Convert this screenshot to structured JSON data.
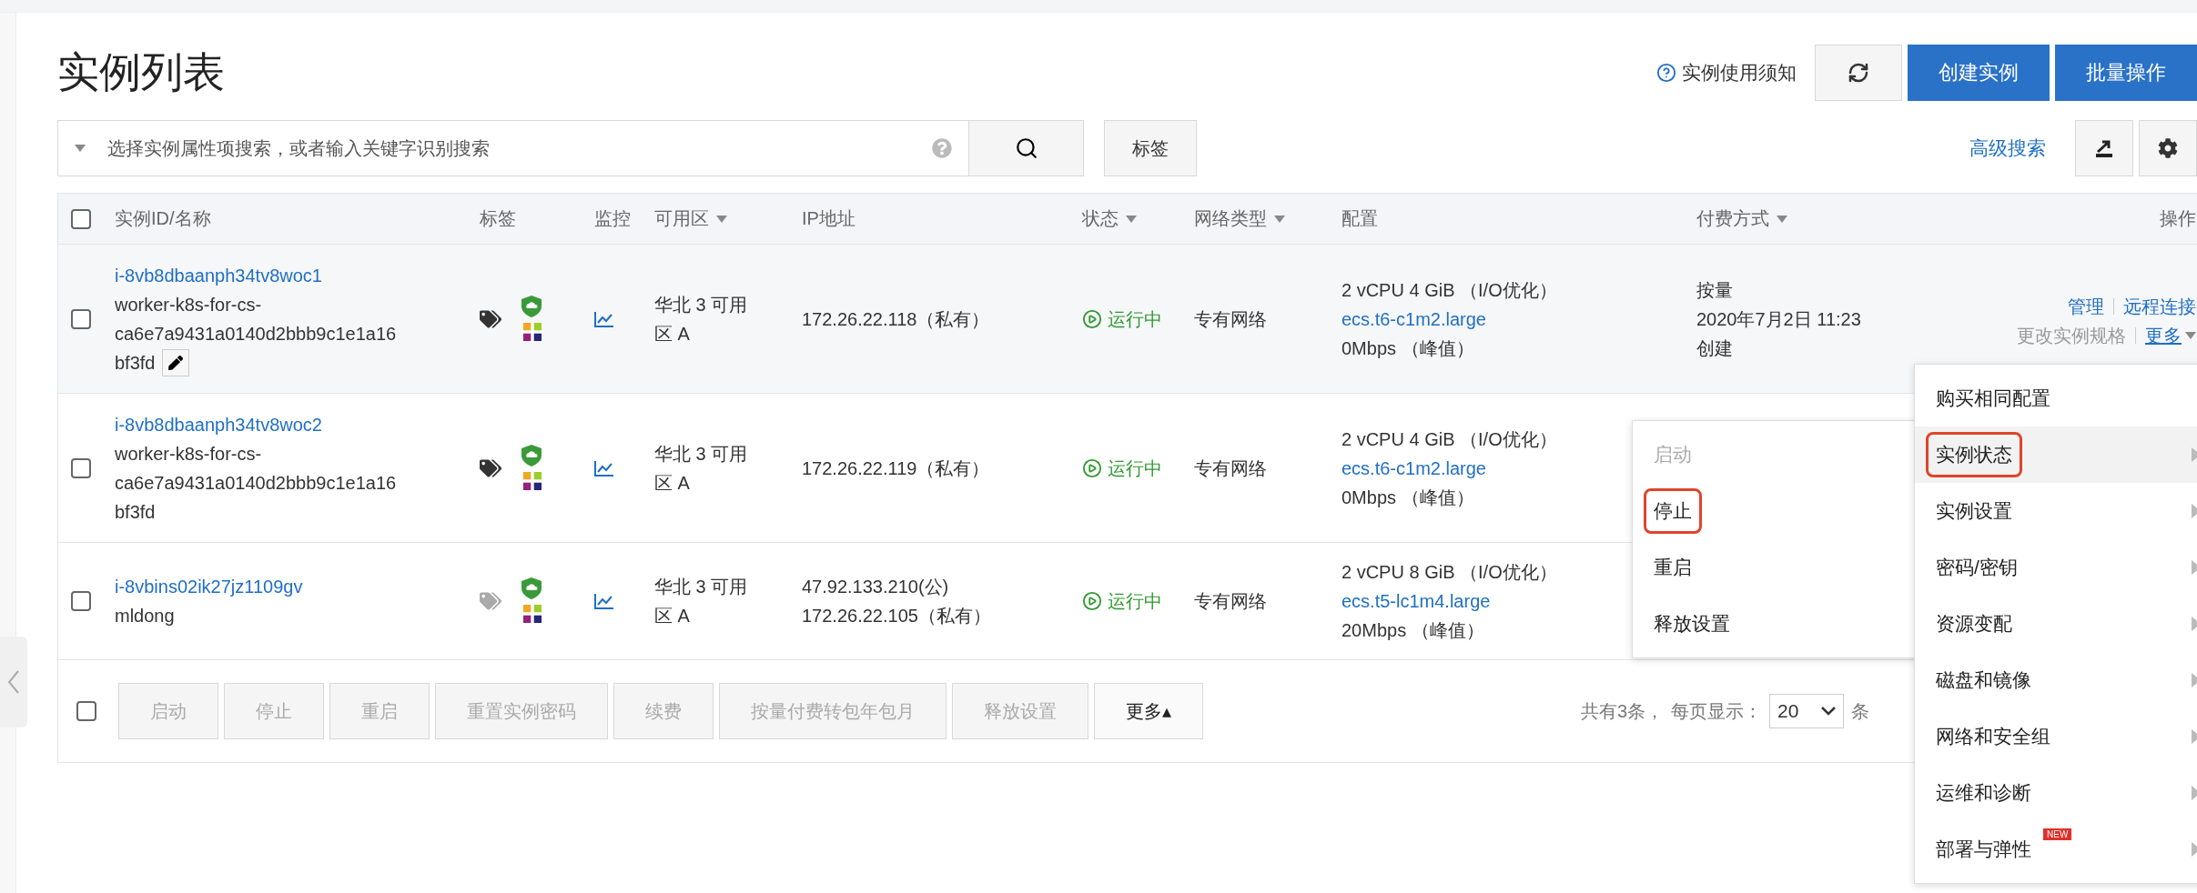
{
  "page_title": "实例列表",
  "header_actions": {
    "notice": "实例使用须知",
    "buttons": [
      {
        "label": "创建实例"
      },
      {
        "label": "批量操作"
      }
    ]
  },
  "search": {
    "placeholder": "选择实例属性项搜索，或者输入关键字识别搜索",
    "tag_button": "标签",
    "advanced": "高级搜索"
  },
  "table": {
    "header_checked": false,
    "columns": [
      {
        "label": "实例ID/名称",
        "sortable": false
      },
      {
        "label": "标签",
        "sortable": false
      },
      {
        "label": "监控",
        "sortable": false
      },
      {
        "label": "可用区",
        "sortable": true
      },
      {
        "label": "IP地址",
        "sortable": false
      },
      {
        "label": "状态",
        "sortable": true
      },
      {
        "label": "网络类型",
        "sortable": true
      },
      {
        "label": "配置",
        "sortable": false
      },
      {
        "label": "付费方式",
        "sortable": true
      },
      {
        "label": "操作",
        "sortable": false
      }
    ],
    "rows": [
      {
        "checked": false,
        "hovered": true,
        "id": "i-8vb8dbaanph34tv8woc1",
        "name_lines": [
          "worker-k8s-for-cs-",
          "ca6e7a9431a0140d2bbb9c1e1a16",
          "bf3fd"
        ],
        "show_edit": true,
        "tagged": true,
        "zone": "华北 3 可用区 A",
        "ips": [
          "172.26.22.118（私有）"
        ],
        "status": "运行中",
        "network": "专有网络",
        "config": [
          "2 vCPU 4 GiB （I/O优化）",
          "ecs.t6-c1m2.large",
          "0Mbps （峰值）"
        ],
        "payment": [
          "按量",
          "2020年7月2日 11:23",
          "创建"
        ],
        "actions": [
          [
            {
              "label": "管理",
              "kind": "link"
            },
            {
              "label": "远程连接",
              "kind": "link"
            }
          ],
          [
            {
              "label": "更改实例规格",
              "kind": "muted"
            },
            {
              "label": "更多",
              "kind": "dropdown"
            }
          ]
        ]
      },
      {
        "checked": false,
        "hovered": false,
        "id": "i-8vb8dbaanph34tv8woc2",
        "name_lines": [
          "worker-k8s-for-cs-",
          "ca6e7a9431a0140d2bbb9c1e1a16",
          "bf3fd"
        ],
        "show_edit": false,
        "tagged": true,
        "zone": "华北 3 可用区 A",
        "ips": [
          "172.26.22.119（私有）"
        ],
        "status": "运行中",
        "network": "专有网络",
        "config": [
          "2 vCPU 4 GiB （I/O优化）",
          "ecs.t6-c1m2.large",
          "0Mbps （峰值）"
        ]
      },
      {
        "checked": false,
        "hovered": false,
        "id": "i-8vbins02ik27jz1109gv",
        "name_lines": [
          "mldong"
        ],
        "show_edit": false,
        "tagged": false,
        "zone": "华北 3 可用区 A",
        "ips": [
          "47.92.133.210(公)",
          "172.26.22.105（私有）"
        ],
        "status": "运行中",
        "network": "专有网络",
        "config": [
          "2 vCPU 8 GiB （I/O优化）",
          "ecs.t5-lc1m4.large",
          "20Mbps （峰值）"
        ]
      }
    ]
  },
  "footer": {
    "checked": false,
    "buttons": [
      {
        "label": "启动",
        "disabled": true
      },
      {
        "label": "停止",
        "disabled": true
      },
      {
        "label": "重启",
        "disabled": true
      },
      {
        "label": "重置实例密码",
        "disabled": true
      },
      {
        "label": "续费",
        "disabled": true
      },
      {
        "label": "按量付费转包年包月",
        "disabled": true
      },
      {
        "label": "释放设置",
        "disabled": true
      },
      {
        "label": "更多▴",
        "disabled": false
      }
    ],
    "total": "共有3条，",
    "per_page_label": "每页显示：",
    "per_page": "20",
    "unit": "条"
  },
  "menu": {
    "items": [
      {
        "label": "购买相同配置",
        "has_submenu": false,
        "selected": false,
        "highlighted": false
      },
      {
        "label": "实例状态",
        "has_submenu": true,
        "selected": true,
        "highlighted": true
      },
      {
        "label": "实例设置",
        "has_submenu": true,
        "selected": false,
        "highlighted": false
      },
      {
        "label": "密码/密钥",
        "has_submenu": true,
        "selected": false,
        "highlighted": false
      },
      {
        "label": "资源变配",
        "has_submenu": true,
        "selected": false,
        "highlighted": false
      },
      {
        "label": "磁盘和镜像",
        "has_submenu": true,
        "selected": false,
        "highlighted": false
      },
      {
        "label": "网络和安全组",
        "has_submenu": true,
        "selected": false,
        "highlighted": false
      },
      {
        "label": "运维和诊断",
        "has_submenu": true,
        "selected": false,
        "highlighted": false
      },
      {
        "label": "部署与弹性",
        "has_submenu": true,
        "selected": false,
        "highlighted": false,
        "badge": "NEW"
      }
    ]
  },
  "submenu": {
    "items": [
      {
        "label": "启动",
        "disabled": true,
        "highlighted": false
      },
      {
        "label": "停止",
        "disabled": false,
        "highlighted": true
      },
      {
        "label": "重启",
        "disabled": false,
        "highlighted": false
      },
      {
        "label": "释放设置",
        "disabled": false,
        "highlighted": false
      }
    ]
  }
}
